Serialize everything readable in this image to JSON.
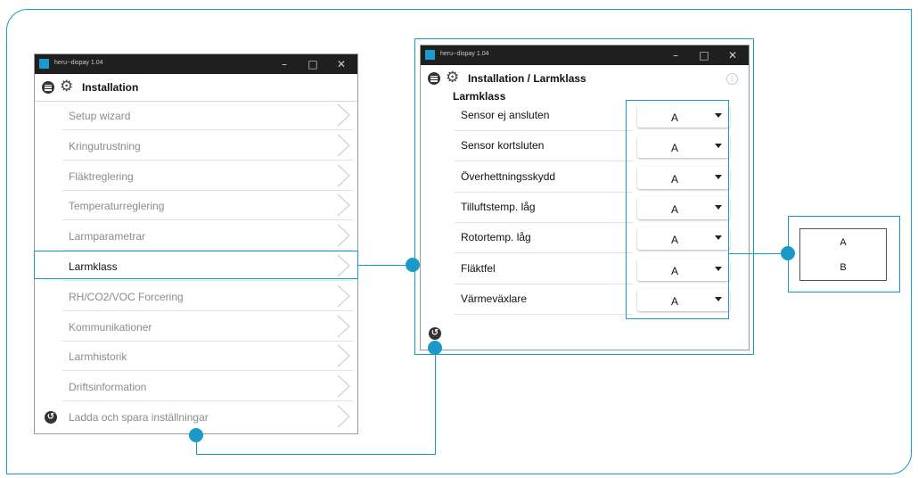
{
  "left_window": {
    "title": "heru--dispay 1.04",
    "controls": {
      "minimize": "–",
      "maximize": "□",
      "close": "✕"
    },
    "header_title": "Installation",
    "items": [
      {
        "label": "Setup wizard"
      },
      {
        "label": "Kringutrustning"
      },
      {
        "label": "Fläktreglering"
      },
      {
        "label": "Temperaturreglering"
      },
      {
        "label": "Larmparametrar"
      },
      {
        "label": "Larmklass"
      },
      {
        "label": "RH/CO2/VOC Forcering"
      },
      {
        "label": "Kommunikationer"
      },
      {
        "label": "Larmhistorik"
      },
      {
        "label": "Driftsinformation"
      },
      {
        "label": "Ladda och spara inställningar"
      }
    ],
    "selected_item": "Larmklass"
  },
  "right_window": {
    "title": "heru--dispay 1.04",
    "controls": {
      "minimize": "–",
      "maximize": "□",
      "close": "✕"
    },
    "header_title": "Installation / Larmklass",
    "info_icon": "i",
    "section_title": "Larmklass",
    "rows": [
      {
        "label": "Sensor ej ansluten",
        "value": "A"
      },
      {
        "label": "Sensor kortsluten",
        "value": "A"
      },
      {
        "label": "Överhettningsskydd",
        "value": "A"
      },
      {
        "label": "Tilluftstemp. låg",
        "value": "A"
      },
      {
        "label": "Rotortemp. låg",
        "value": "A"
      },
      {
        "label": "Fläktfel",
        "value": "A"
      },
      {
        "label": "Värmeväxlare",
        "value": "A"
      }
    ]
  },
  "dropdown_options": [
    "A",
    "B"
  ],
  "icons": {
    "back": "back-arrow-icon",
    "menu": "menu-icon",
    "gear": "gear-icon",
    "chevron": "chevron-right-icon"
  },
  "colors": {
    "accent": "#1b9ac8",
    "titlebar": "#1f1f1f",
    "app_icon": "#1a9bd0"
  }
}
